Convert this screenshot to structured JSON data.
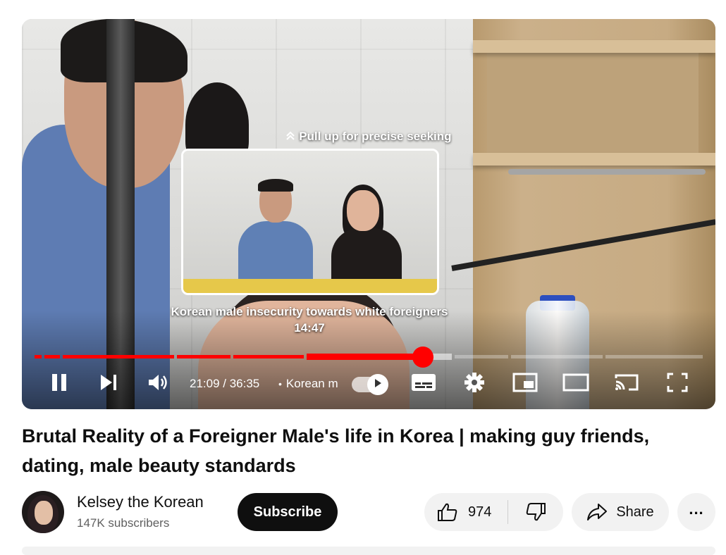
{
  "player": {
    "seek_hint": "Pull up for precise seeking",
    "preview_chapter_title": "Korean male insecurity towards white foreigners",
    "preview_time": "14:47",
    "current_time": "21:09",
    "time_separator": " / ",
    "duration": "36:35",
    "chapter_dot": "•",
    "chapter_label": "Korean m",
    "progress": {
      "played_fraction": 0.578,
      "hover_fraction": 0.41
    },
    "icons": {
      "play_pause": "pause-icon",
      "next": "next-icon",
      "volume": "volume-icon",
      "autoplay": "autoplay-toggle-icon",
      "subtitles": "subtitles-icon",
      "settings": "settings-icon",
      "miniplayer": "miniplayer-icon",
      "theater": "theater-mode-icon",
      "cast": "cast-icon",
      "fullscreen": "fullscreen-icon"
    },
    "accent_color": "#ff0000"
  },
  "video": {
    "title": "Brutal Reality of a Foreigner Male's life in Korea | making guy friends, dating, male beauty standards"
  },
  "channel": {
    "name": "Kelsey the Korean",
    "subscribers": "147K subscribers",
    "subscribe_label": "Subscribe"
  },
  "actions": {
    "like_count": "974",
    "share_label": "Share",
    "more_label": "..."
  }
}
